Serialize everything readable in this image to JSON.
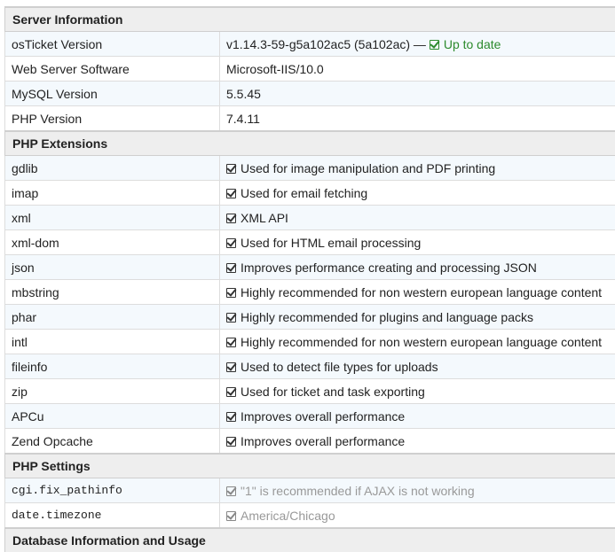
{
  "colors": {
    "ok_green": "#2c8a2c",
    "muted_gray": "#999999",
    "section_bg": "#eeeeee",
    "row_alt_bg": "#f4f9fd"
  },
  "server_information": {
    "title": "Server Information",
    "osticket_version": {
      "label": "osTicket Version",
      "value": "v1.14.3-59-g5a102ac5 (5a102ac) —",
      "status": "Up to date",
      "status_icon": "check-square-icon"
    },
    "web_server_software": {
      "label": "Web Server Software",
      "value": "Microsoft-IIS/10.0"
    },
    "mysql_version": {
      "label": "MySQL Version",
      "value": "5.5.45"
    },
    "php_version": {
      "label": "PHP Version",
      "value": "7.4.11"
    }
  },
  "php_extensions": {
    "title": "PHP Extensions",
    "icon": "check-square-icon",
    "items": [
      {
        "name": "gdlib",
        "description": "Used for image manipulation and PDF printing"
      },
      {
        "name": "imap",
        "description": "Used for email fetching"
      },
      {
        "name": "xml",
        "description": "XML API"
      },
      {
        "name": "xml-dom",
        "description": "Used for HTML email processing"
      },
      {
        "name": "json",
        "description": "Improves performance creating and processing JSON"
      },
      {
        "name": "mbstring",
        "description": "Highly recommended for non western european language content"
      },
      {
        "name": "phar",
        "description": "Highly recommended for plugins and language packs"
      },
      {
        "name": "intl",
        "description": "Highly recommended for non western european language content"
      },
      {
        "name": "fileinfo",
        "description": "Used to detect file types for uploads"
      },
      {
        "name": "zip",
        "description": "Used for ticket and task exporting"
      },
      {
        "name": "APCu",
        "description": "Improves overall performance"
      },
      {
        "name": "Zend Opcache",
        "description": "Improves overall performance"
      }
    ]
  },
  "php_settings": {
    "title": "PHP Settings",
    "items": [
      {
        "name": "cgi.fix_pathinfo",
        "description": "\"1\" is recommended if AJAX is not working"
      },
      {
        "name": "date.timezone",
        "description": "America/Chicago"
      }
    ]
  },
  "database_information": {
    "title": "Database Information and Usage"
  }
}
